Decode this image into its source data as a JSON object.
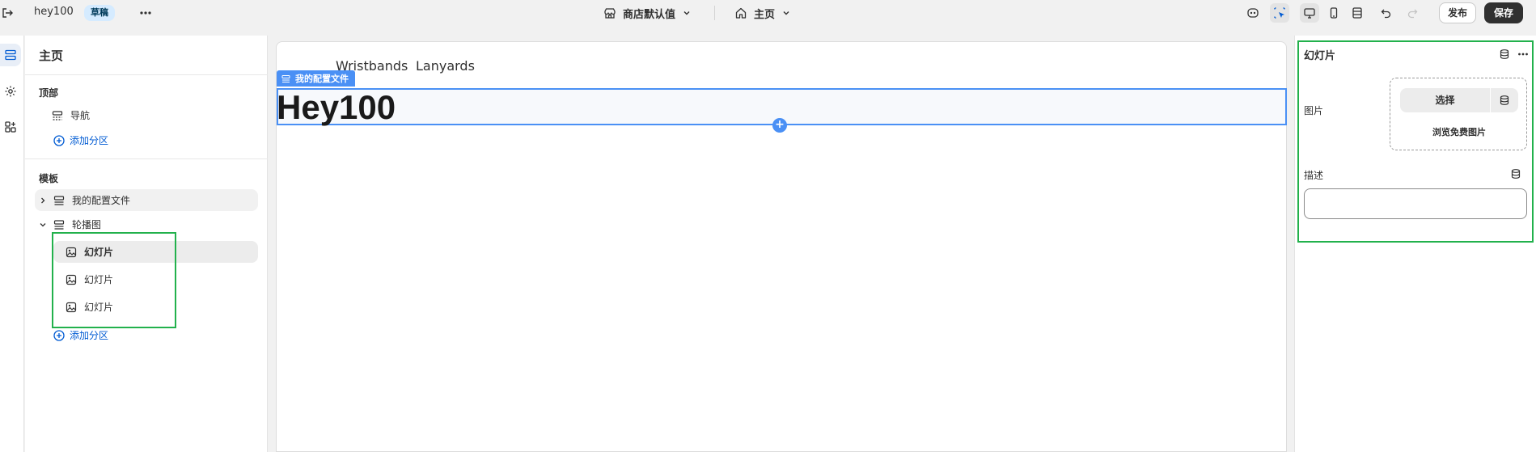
{
  "topbar": {
    "store_name": "hey100",
    "status_badge": "草稿",
    "theme_label": "商店默认值",
    "page_label": "主页",
    "publish_label": "发布",
    "save_label": "保存"
  },
  "sidebar": {
    "title": "主页",
    "header_group": {
      "title": "顶部",
      "items": [
        {
          "label": "导航",
          "icon": "section-icon"
        }
      ],
      "add_label": "添加分区"
    },
    "template_group": {
      "title": "模板",
      "items": [
        {
          "label": "我的配置文件",
          "icon": "section-icon",
          "expanded": false
        },
        {
          "label": "轮播图",
          "icon": "section-icon",
          "expanded": true,
          "children": [
            {
              "label": "幻灯片",
              "icon": "image-icon",
              "selected": true
            },
            {
              "label": "幻灯片",
              "icon": "image-icon",
              "selected": false
            },
            {
              "label": "幻灯片",
              "icon": "image-icon",
              "selected": false
            }
          ]
        }
      ],
      "add_label": "添加分区"
    }
  },
  "canvas": {
    "nav_links": [
      "Wristbands",
      "Lanyards"
    ],
    "section_tag": "我的配置文件",
    "heading": "Hey100",
    "add_symbol": "+"
  },
  "inspector": {
    "title": "幻灯片",
    "image_label": "图片",
    "select_button": "选择",
    "browse_free": "浏览免费图片",
    "description_label": "描述",
    "description_value": ""
  },
  "colors": {
    "accent_blue": "#4a90f5",
    "highlight_green": "#22b14c",
    "link_blue": "#005bd3",
    "badge_bg": "#d5ebff"
  }
}
